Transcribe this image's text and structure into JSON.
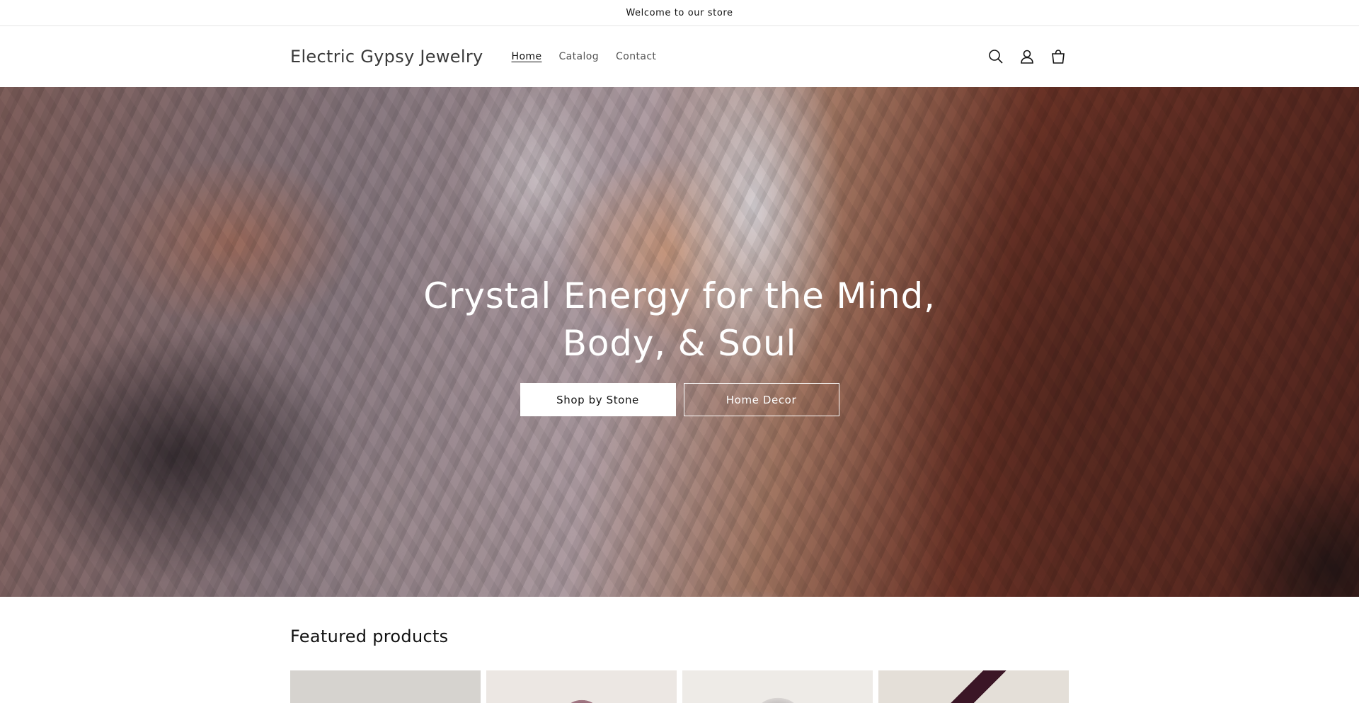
{
  "announcement": {
    "text": "Welcome to our store"
  },
  "header": {
    "logo": "Electric Gypsy Jewelry",
    "nav": [
      {
        "label": "Home",
        "active": true
      },
      {
        "label": "Catalog",
        "active": false
      },
      {
        "label": "Contact",
        "active": false
      }
    ],
    "icons": [
      "search-icon",
      "account-icon",
      "cart-icon"
    ]
  },
  "hero": {
    "title": "Crystal Energy for the Mind, Body, & Soul",
    "primary_button": "Shop by Stone",
    "secondary_button": "Home Decor"
  },
  "featured": {
    "title": "Featured products",
    "products": [
      {
        "image": "product-image-1"
      },
      {
        "image": "product-image-2"
      },
      {
        "image": "product-image-3"
      },
      {
        "image": "product-image-4"
      }
    ]
  },
  "colors": {
    "text": "#121212",
    "background": "#ffffff",
    "nav_text": "#555555"
  }
}
